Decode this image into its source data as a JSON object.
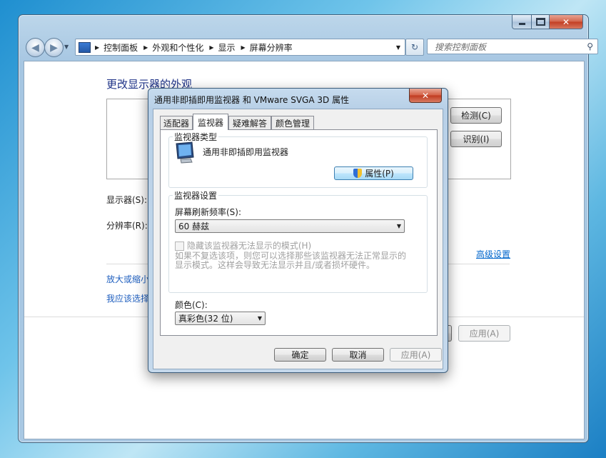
{
  "window": {
    "address_crumbs": [
      "控制面板",
      "外观和个性化",
      "显示",
      "屏幕分辨率"
    ],
    "search_placeholder": "搜索控制面板"
  },
  "main": {
    "heading": "更改显示器的外观",
    "detect_button": "检测(C)",
    "identify_button": "识别(I)",
    "display_label": "显示器(S):",
    "resolution_label": "分辨率(R):",
    "advanced_link": "高级设置",
    "link_enlarge": "放大或缩小",
    "link_choose": "我应该选择",
    "apply_button": "应用(A)"
  },
  "dialog": {
    "title": "通用非即插即用监视器 和 VMware SVGA 3D 属性",
    "tabs": [
      "适配器",
      "监视器",
      "疑难解答",
      "颜色管理"
    ],
    "active_tab": "监视器",
    "monitor_type_group": "监视器类型",
    "monitor_name": "通用非即插即用监视器",
    "properties_button": "属性(P)",
    "monitor_settings_group": "监视器设置",
    "refresh_rate_label": "屏幕刷新频率(S):",
    "refresh_rate_value": "60 赫兹",
    "hide_modes_checkbox": "隐藏该监视器无法显示的模式(H)",
    "hide_modes_desc_line1": "如果不复选该项，则您可以选择那些该监视器无法正常显示的",
    "hide_modes_desc_line2": "显示模式。这样会导致无法显示并且/或者损坏硬件。",
    "colors_label": "颜色(C):",
    "colors_value": "真彩色(32 位)",
    "ok_button": "确定",
    "cancel_button": "取消",
    "apply_button": "应用(A)"
  }
}
